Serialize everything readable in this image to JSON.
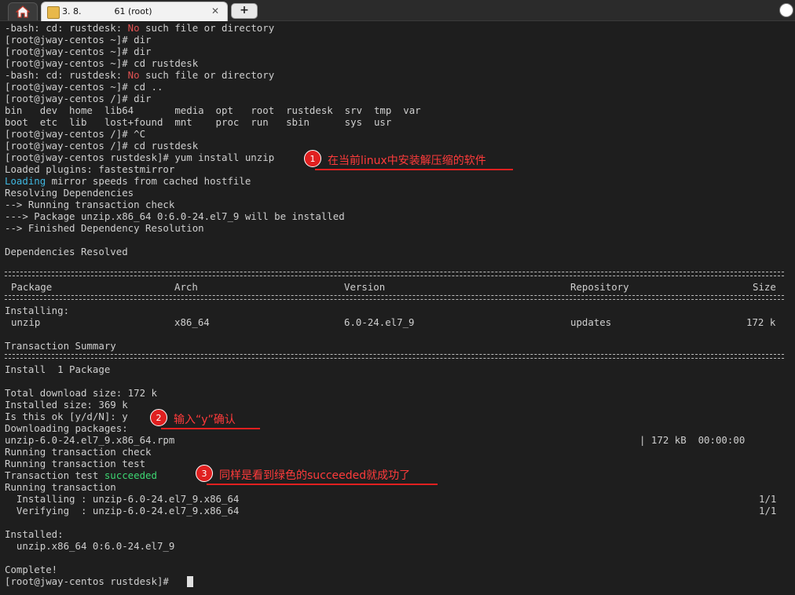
{
  "tabbar": {
    "session_title": "3. 8.            61 (root)",
    "close_label": "✕",
    "new_tab_label": "+"
  },
  "icons": [
    "home-icon",
    "key-icon",
    "close-icon",
    "plus-icon",
    "menu-icon"
  ],
  "colors": {
    "background": "#1e1e1e",
    "text": "#cfcfcf",
    "error": "#e05252",
    "info": "#3fb7e0",
    "success": "#3dd672",
    "annotation": "#e02020"
  },
  "terminal": {
    "l1": {
      "a": "-bash: cd: rustdesk: ",
      "b": "No",
      "c": " such file or directory"
    },
    "l2": "[root@jway-centos ~]# dir",
    "l3": "[root@jway-centos ~]# dir",
    "l4": "[root@jway-centos ~]# cd rustdesk",
    "l5": {
      "a": "-bash: cd: rustdesk: ",
      "b": "No",
      "c": " such file or directory"
    },
    "l6": "[root@jway-centos ~]# cd ..",
    "l7": "[root@jway-centos /]# dir",
    "l8": "bin   dev  home  lib64       media  opt   root  rustdesk  srv  tmp  var",
    "l9": "boot  etc  lib   lost+found  mnt    proc  run   sbin      sys  usr",
    "l10": "[root@jway-centos /]# ^C",
    "l11": "[root@jway-centos /]# cd rustdesk",
    "l12": "[root@jway-centos rustdesk]# yum install unzip",
    "l13": "Loaded plugins: fastestmirror",
    "l14": {
      "a": "Loading",
      "b": " mirror speeds from cached hostfile"
    },
    "l15": "Resolving Dependencies",
    "l16": "--> Running transaction check",
    "l17": "---> Package unzip.x86_64 0:6.0-24.el7_9 will be installed",
    "l18": "--> Finished Dependency Resolution",
    "l19": "Dependencies Resolved",
    "th_package": "Package",
    "th_arch": "Arch",
    "th_version": "Version",
    "th_repository": "Repository",
    "th_size": "Size",
    "installing": "Installing:",
    "row_package": "unzip",
    "row_arch": "x86_64",
    "row_version": "6.0-24.el7_9",
    "row_repository": "updates",
    "row_size": "172 k",
    "tx_summary": "Transaction Summary",
    "install_count": "Install  1 Package",
    "total_download": "Total download size: 172 k",
    "installed_size": "Installed size: 369 k",
    "is_ok": "Is this ok [y/d/N]: y",
    "downloading": "Downloading packages:",
    "rpm_file": "unzip-6.0-24.el7_9.x86_64.rpm",
    "rpm_progress": "| 172 kB  00:00:00",
    "running_check": "Running transaction check",
    "running_test": "Running transaction test",
    "tx_test": {
      "a": "Transaction test ",
      "b": "succeeded"
    },
    "running_tx": "Running transaction",
    "installing_line": "  Installing : unzip-6.0-24.el7_9.x86_64",
    "installing_count": "1/1",
    "verifying_line": "  Verifying  : unzip-6.0-24.el7_9.x86_64",
    "verifying_count": "1/1",
    "installed_hdr": "Installed:",
    "installed_pkg": "  unzip.x86_64 0:6.0-24.el7_9",
    "complete": "Complete!",
    "prompt": "[root@jway-centos rustdesk]# "
  },
  "annotations": [
    {
      "num": "1",
      "text": "在当前linux中安装解压缩的软件"
    },
    {
      "num": "2",
      "text": "输入“y”确认"
    },
    {
      "num": "3",
      "text": "同样是看到绿色的succeeded就成功了"
    }
  ]
}
